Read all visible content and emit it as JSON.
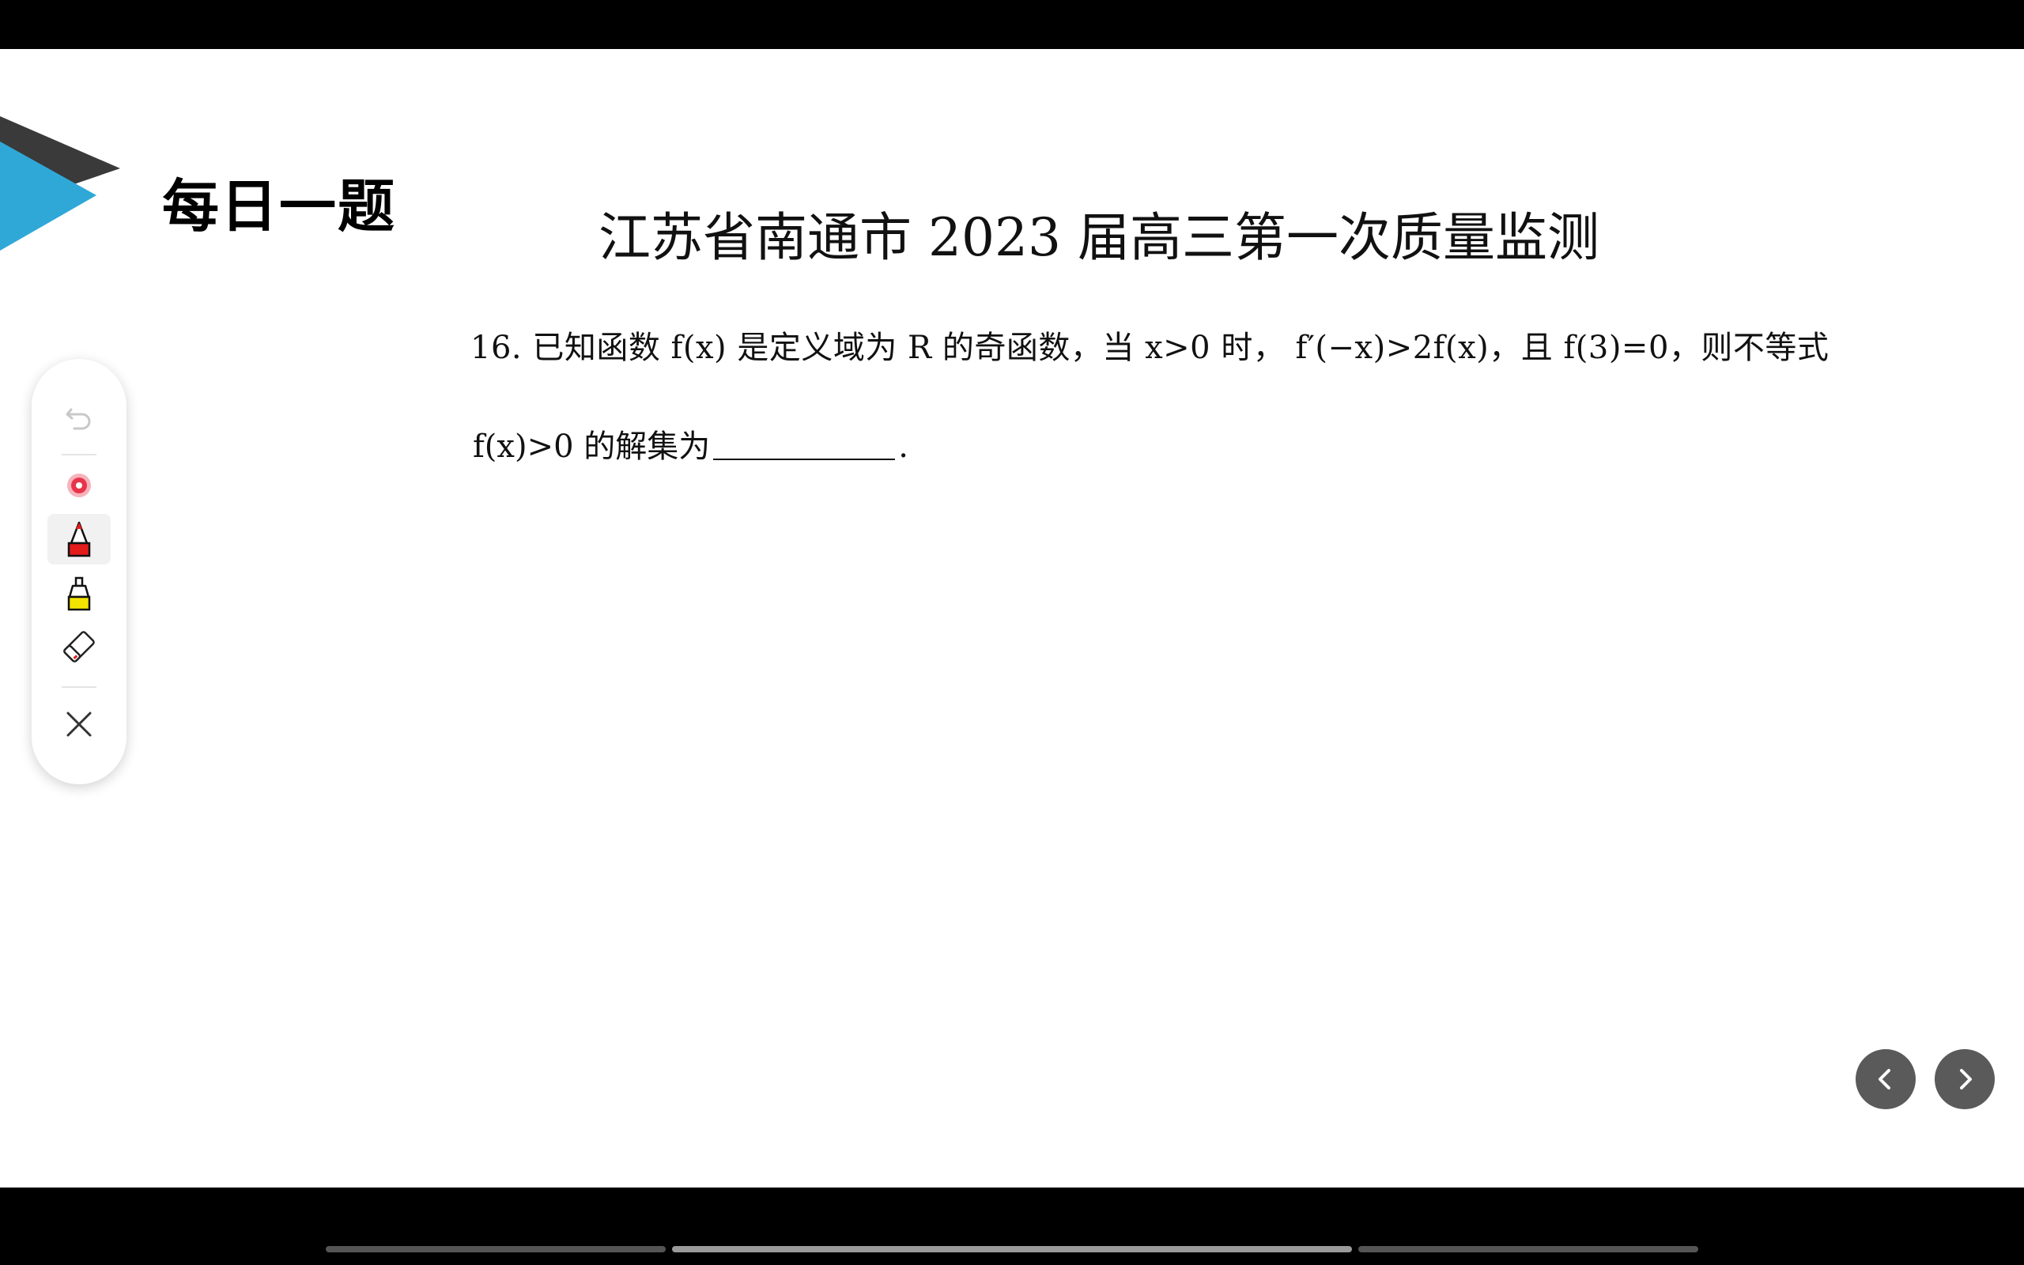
{
  "slide": {
    "section_title": "每日一题",
    "exam_title": "江苏省南通市 2023 届高三第一次质量监测",
    "question": {
      "line1": "16. 已知函数 f(x) 是定义域为 R 的奇函数，当 x>0 时， f′(−x)>2f(x)，且 f(3)=0，则不等式",
      "line2_prefix": "f(x)>0 的解集为",
      "line2_suffix": "."
    }
  },
  "toolbar": {
    "tools": [
      {
        "icon": "undo-icon",
        "enabled": false
      },
      {
        "icon": "laser-pointer-icon",
        "color": "#e8344a"
      },
      {
        "icon": "pen-icon",
        "color": "#e41b1b",
        "selected": true
      },
      {
        "icon": "highlighter-icon",
        "color": "#f3e300"
      },
      {
        "icon": "eraser-icon"
      },
      {
        "icon": "close-icon"
      }
    ]
  },
  "navigation": {
    "prev_icon": "chevron-left-icon",
    "next_icon": "chevron-right-icon"
  },
  "colors": {
    "accent_blue": "#2fa8d8",
    "accent_dark": "#3a3a3a"
  }
}
